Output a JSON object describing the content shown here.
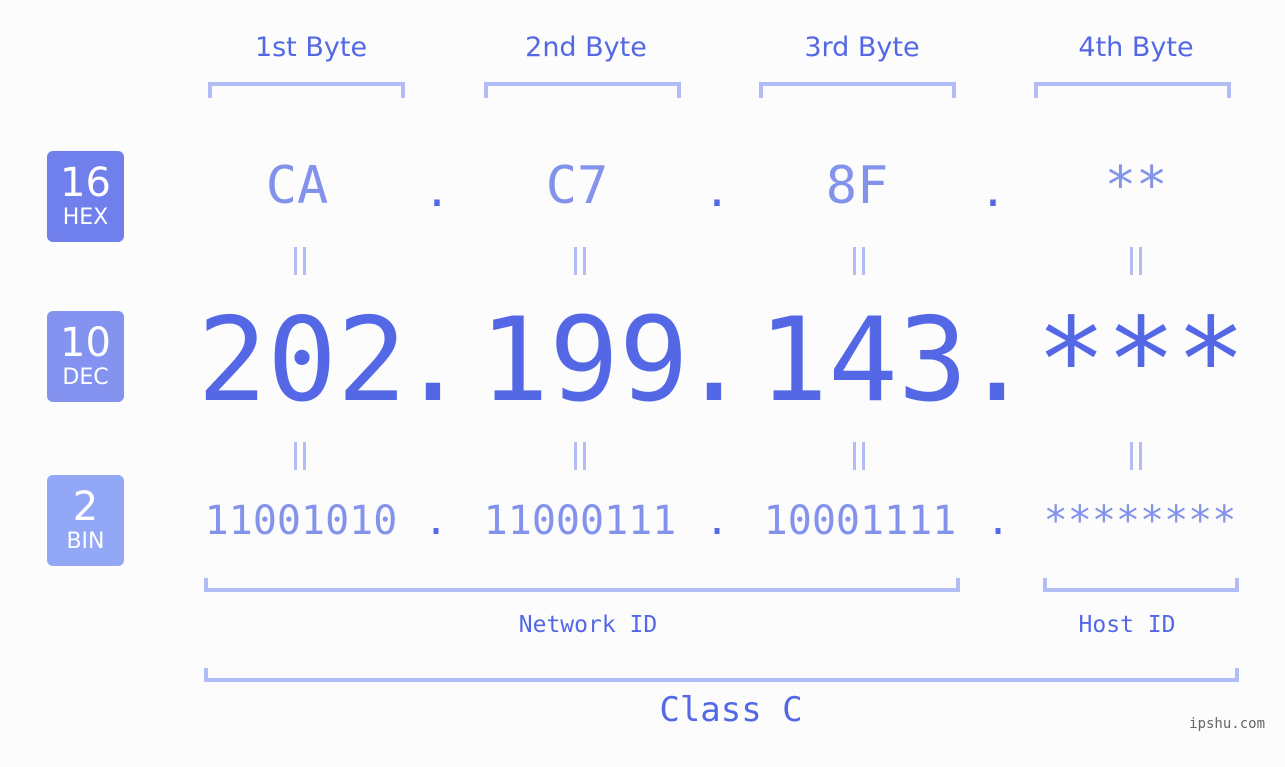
{
  "byte_headers": [
    "1st Byte",
    "2nd Byte",
    "3rd Byte",
    "4th Byte"
  ],
  "badges": {
    "hex": {
      "num": "16",
      "label": "HEX",
      "color": "#6f7feb"
    },
    "dec": {
      "num": "10",
      "label": "DEC",
      "color": "#8393ef"
    },
    "bin": {
      "num": "2",
      "label": "BIN",
      "color": "#92a7f6"
    }
  },
  "hex": [
    "CA",
    "C7",
    "8F",
    "**"
  ],
  "dec": [
    "202",
    "199",
    "143",
    "***"
  ],
  "bin": [
    "11001010",
    "11000111",
    "10001111",
    "********"
  ],
  "separator": ".",
  "equals_sign": "=",
  "network_id_label": "Network ID",
  "host_id_label": "Host ID",
  "class_label": "Class C",
  "watermark": "ipshu.com",
  "colors": {
    "primary": "#5468e6",
    "secondary": "#8393ec",
    "bracket": "#b3bdf5",
    "background": "#fbfcfb"
  }
}
